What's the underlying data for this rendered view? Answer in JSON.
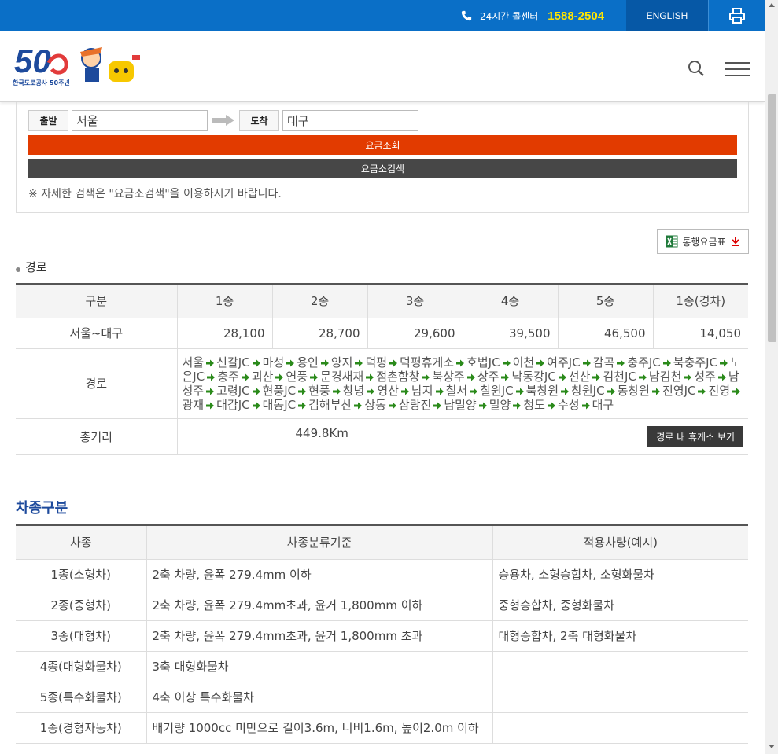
{
  "topbar": {
    "call_label": "24시간 콜센터",
    "call_number": "1588-2504",
    "english": "ENGLISH"
  },
  "header": {
    "logo_text": "한국도로공사 50주년",
    "logo_number": "50"
  },
  "search": {
    "depart_label": "출발",
    "depart_value": "서울",
    "arrive_label": "도착",
    "arrive_value": "대구",
    "fare_button": "요금조회",
    "tollgate_button": "요금소검색",
    "note": "※ 자세한 검색은 \"요금소검색\"을 이용하시기 바랍니다."
  },
  "download": {
    "label": "통행요금표"
  },
  "route_section": {
    "title": "경로"
  },
  "fare_table": {
    "headers": [
      "구분",
      "1종",
      "2종",
      "3종",
      "4종",
      "5종",
      "1종(경차)"
    ],
    "row_label": "서울~대구",
    "fares": [
      "28,100",
      "28,700",
      "29,600",
      "39,500",
      "46,500",
      "14,050"
    ],
    "route_label": "경로",
    "route": [
      "서울",
      "신갈JC",
      "마성",
      "용인",
      "양지",
      "덕평",
      "덕평휴게소",
      "호법JC",
      "이천",
      "여주JC",
      "감곡",
      "충주JC",
      "북충주JC",
      "노은JC",
      "충주",
      "괴산",
      "연풍",
      "문경새재",
      "점촌함창",
      "북상주",
      "상주",
      "낙동강JC",
      "선산",
      "김천JC",
      "남김천",
      "성주",
      "남성주",
      "고령JC",
      "현풍JC",
      "현풍",
      "창녕",
      "영산",
      "남지",
      "칠서",
      "칠원JC",
      "북창원",
      "창원JC",
      "동창원",
      "진영JC",
      "진영",
      "광재",
      "대감JC",
      "대동JC",
      "김해부산",
      "상동",
      "삼랑진",
      "남밀양",
      "밀양",
      "청도",
      "수성",
      "대구"
    ],
    "distance_label": "총거리",
    "distance_value": "449.8Km",
    "rest_button": "경로 내 휴게소 보기"
  },
  "vehicle_section": {
    "title": "차종구분",
    "headers": [
      "차종",
      "차종분류기준",
      "적용차량(예시)"
    ],
    "rows": [
      [
        "1종(소형차)",
        "2축 차량, 윤폭 279.4mm 이하",
        "승용차, 소형승합차, 소형화물차"
      ],
      [
        "2종(중형차)",
        "2축 차량, 윤폭 279.4mm초과, 윤거 1,800mm 이하",
        "중형승합차, 중형화물차"
      ],
      [
        "3종(대형차)",
        "2축 차량, 윤폭 279.4mm초과, 윤거 1,800mm 초과",
        "대형승합차, 2축 대형화물차"
      ],
      [
        "4종(대형화물차)",
        "3축 대형화물차",
        ""
      ],
      [
        "5종(특수화물차)",
        "4축 이상 특수화물차",
        ""
      ],
      [
        "1종(경형자동차)",
        "배기량 1000cc 미만으로 길이3.6m, 너비1.6m, 높이2.0m 이하",
        ""
      ]
    ]
  },
  "colors": {
    "topbar": "#0a6fc7",
    "english_bg": "#0658a6",
    "call_number": "#ffe600",
    "fare_button": "#e23b00",
    "tollgate_button": "#474747",
    "section_title": "#1d4a9c",
    "route_arrow": "#2a8a1a"
  },
  "icons": [
    "phone-icon",
    "print-icon",
    "search-icon",
    "menu-icon",
    "arrow-right-icon",
    "excel-icon",
    "download-icon",
    "route-arrow-icon"
  ]
}
